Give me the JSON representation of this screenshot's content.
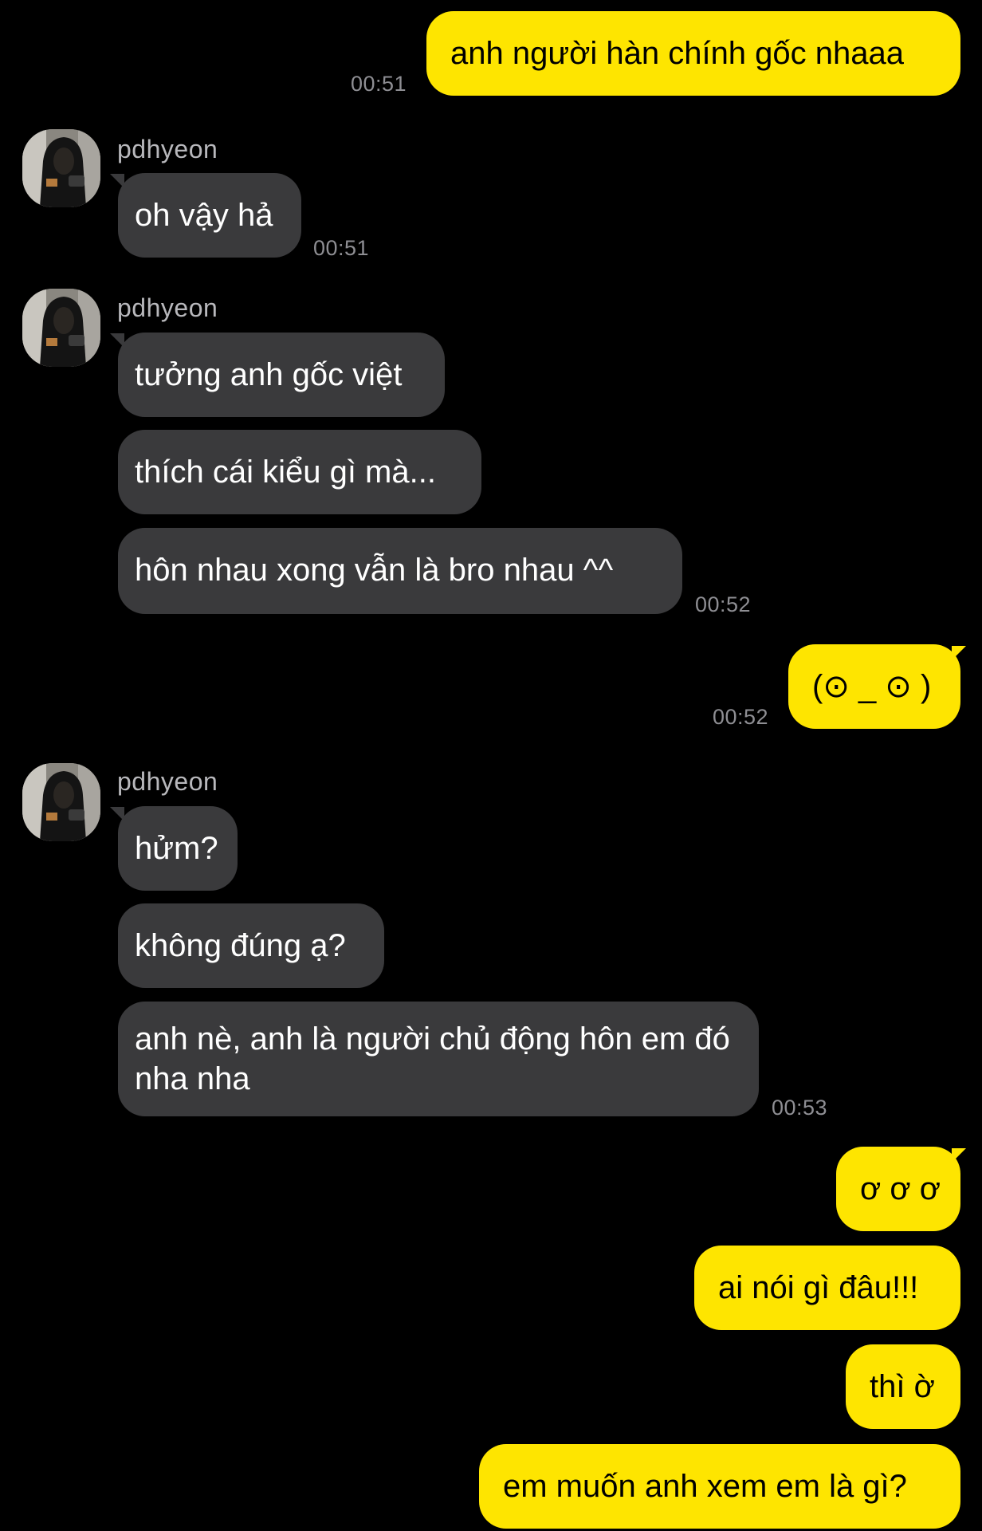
{
  "colors": {
    "background": "#000000",
    "incoming_bubble": "#3a3a3c",
    "outgoing_bubble": "#fee500",
    "timestamp": "#8e8e93",
    "sender_name": "#b8b8bc"
  },
  "contact": {
    "name": "pdhyeon",
    "avatar_icon": "profile-photo-avatar"
  },
  "messages": [
    {
      "dir": "out",
      "text": "anh người hàn chính gốc nhaaa",
      "time": "00:51"
    },
    {
      "dir": "in",
      "text": "oh vậy hả",
      "time": "00:51"
    },
    {
      "dir": "in",
      "text": "tưởng anh gốc việt"
    },
    {
      "dir": "in",
      "text": "thích cái kiểu gì mà..."
    },
    {
      "dir": "in",
      "text": "hôn nhau xong vẫn là bro nhau ^^",
      "time": "00:52"
    },
    {
      "dir": "out",
      "text": "(⊙ _ ⊙ )",
      "time": "00:52"
    },
    {
      "dir": "in",
      "text": "hửm?"
    },
    {
      "dir": "in",
      "text": "không đúng ạ?"
    },
    {
      "dir": "in",
      "text": "anh nè, anh là người chủ động hôn em đó nha nha",
      "time": "00:53"
    },
    {
      "dir": "out",
      "text": "ơ ơ ơ"
    },
    {
      "dir": "out",
      "text": "ai nói gì đâu!!!"
    },
    {
      "dir": "out",
      "text": "thì ờ"
    },
    {
      "dir": "out",
      "text": "em muốn anh xem em là gì?"
    }
  ]
}
